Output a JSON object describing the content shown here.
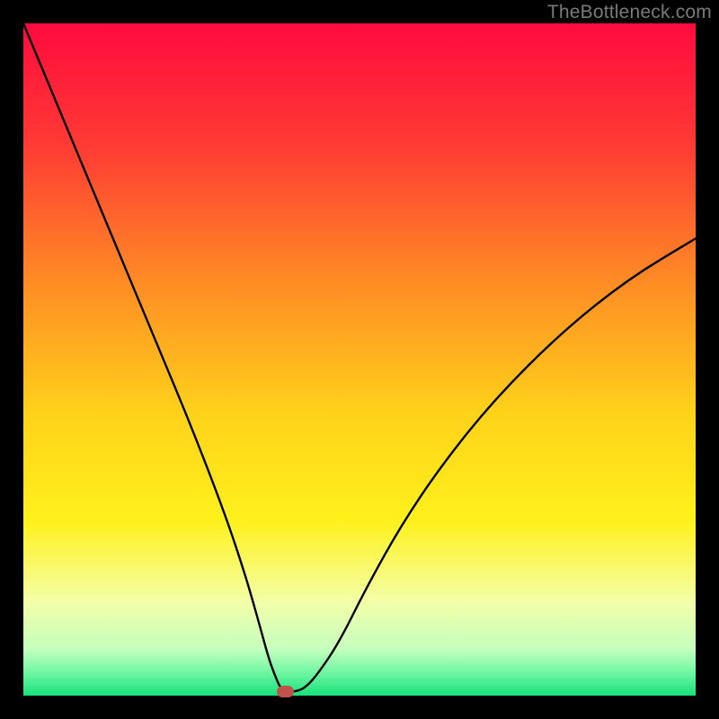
{
  "watermark": {
    "text": "TheBottleneck.com"
  },
  "chart_data": {
    "type": "line",
    "title": "",
    "xlabel": "",
    "ylabel": "",
    "xlim": [
      0,
      100
    ],
    "ylim": [
      0,
      100
    ],
    "gradient_background": {
      "description": "vertical gradient red→orange→yellow→pale-yellow→green",
      "stops": [
        {
          "pos": 0.0,
          "color": "#ff0b3e"
        },
        {
          "pos": 0.18,
          "color": "#ff3a34"
        },
        {
          "pos": 0.38,
          "color": "#ff8a25"
        },
        {
          "pos": 0.58,
          "color": "#ffd21a"
        },
        {
          "pos": 0.74,
          "color": "#fff11c"
        },
        {
          "pos": 0.86,
          "color": "#f3ffa8"
        },
        {
          "pos": 0.93,
          "color": "#c6ffbe"
        },
        {
          "pos": 0.965,
          "color": "#72f7a3"
        },
        {
          "pos": 1.0,
          "color": "#17e07a"
        }
      ]
    },
    "series": [
      {
        "name": "bottleneck-curve",
        "color": "#000000",
        "x": [
          0,
          5,
          10,
          15,
          20,
          25,
          30,
          33,
          35,
          36.5,
          37.5,
          38.2,
          39.0,
          40.5,
          42.0,
          44,
          47,
          51,
          56,
          62,
          70,
          80,
          90,
          100
        ],
        "y": [
          100,
          88,
          76,
          64,
          52,
          40,
          27,
          18,
          11,
          5.5,
          2.8,
          1.2,
          0.6,
          0.6,
          1.2,
          3.5,
          8,
          16,
          25,
          34,
          44,
          54,
          62,
          68
        ]
      }
    ],
    "flat_bottom": {
      "x_start": 37.0,
      "x_end": 41.0,
      "y": 0.6
    },
    "marker": {
      "name": "optimal-point",
      "x": 39.0,
      "y": 0.6,
      "width_pct": 2.6,
      "height_pct": 1.7,
      "color": "#c0524c"
    }
  }
}
